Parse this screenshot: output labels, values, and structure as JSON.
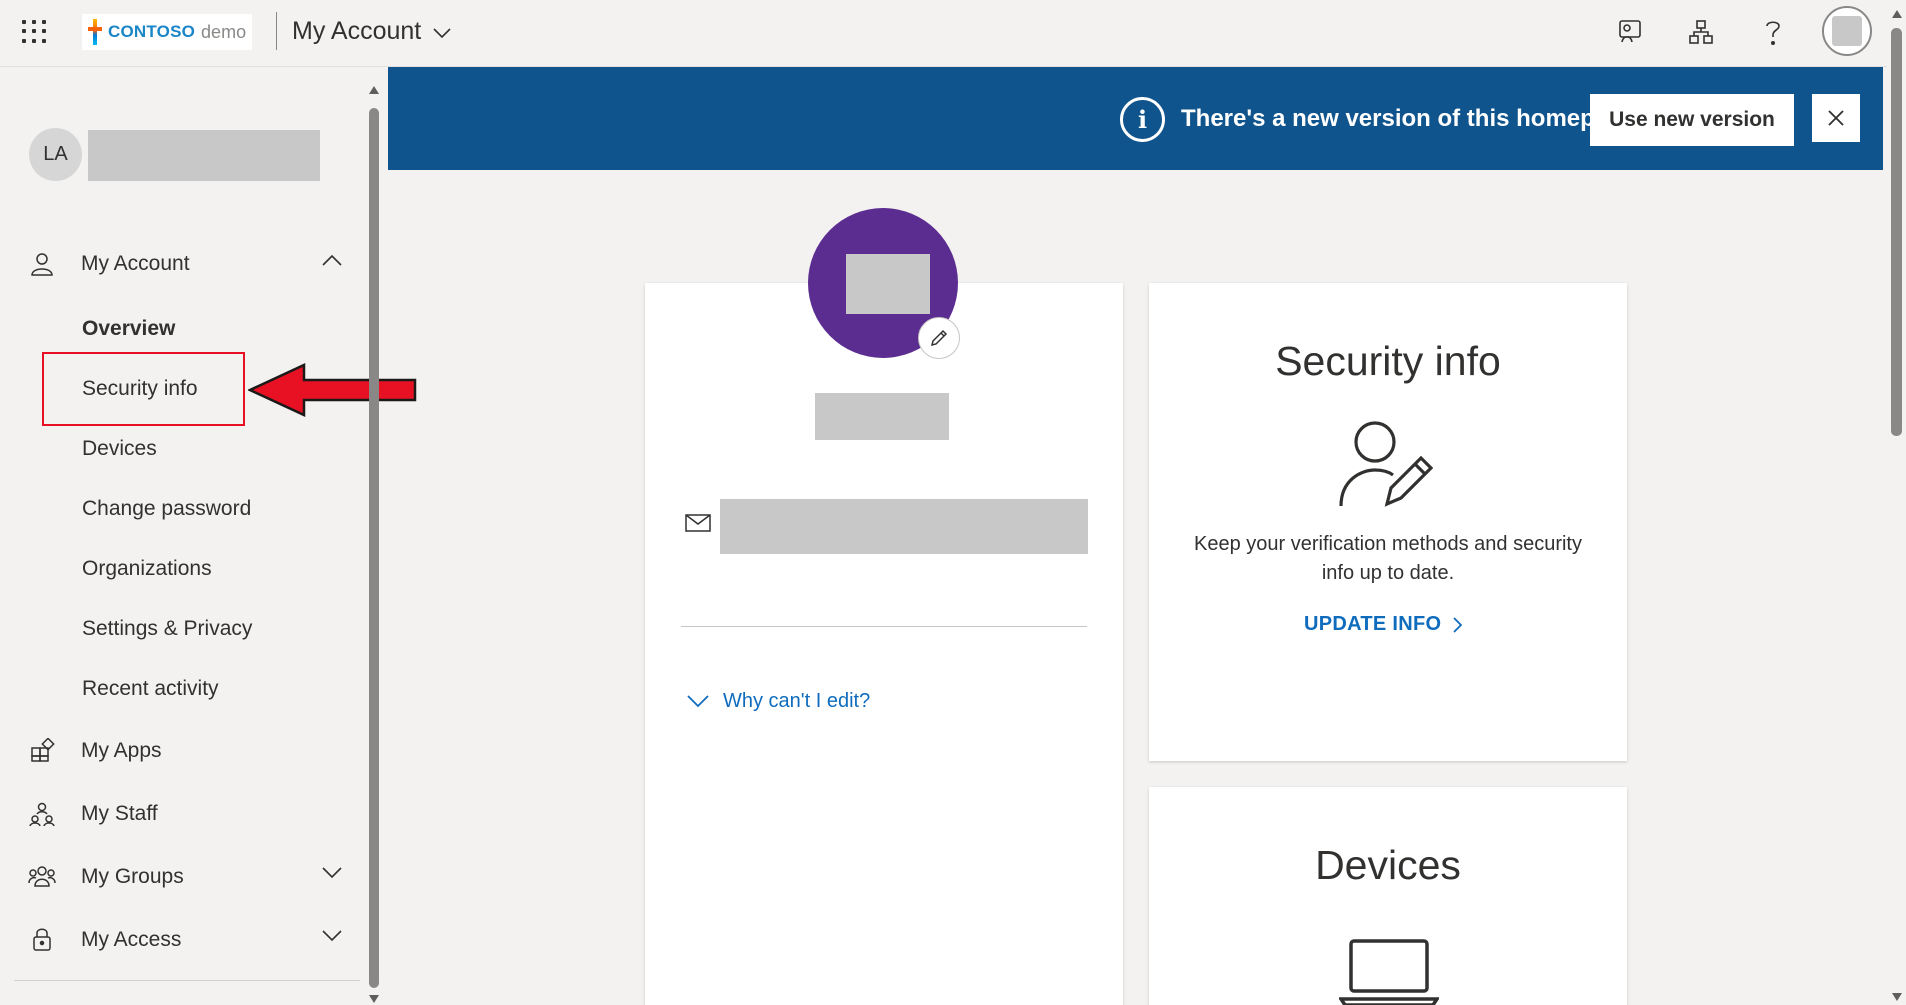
{
  "topbar": {
    "logo_brand": "CONTOSO",
    "logo_sub": "demo",
    "app_title": "My Account",
    "icons": [
      "app-launcher-icon",
      "feedback-icon",
      "org-chart-icon",
      "help-icon",
      "profile-avatar-icon"
    ]
  },
  "sidebar": {
    "user_initials": "LA",
    "my_account_label": "My Account",
    "sub_items": [
      {
        "label": "Overview",
        "selected": true
      },
      {
        "label": "Security info"
      },
      {
        "label": "Devices"
      },
      {
        "label": "Change password"
      },
      {
        "label": "Organizations"
      },
      {
        "label": "Settings & Privacy"
      },
      {
        "label": "Recent activity"
      }
    ],
    "items": [
      {
        "label": "My Apps",
        "icon": "apps-icon"
      },
      {
        "label": "My Staff",
        "icon": "staff-icon"
      },
      {
        "label": "My Groups",
        "icon": "groups-icon"
      },
      {
        "label": "My Access",
        "icon": "access-icon"
      }
    ]
  },
  "banner": {
    "message": "There's a new version of this homepage",
    "button_label": "Use new version",
    "info_glyph": "i"
  },
  "profile": {
    "why_edit_label": "Why can't I edit?"
  },
  "security_card": {
    "title": "Security info",
    "description": "Keep your verification methods and security info up to date.",
    "link_label": "UPDATE INFO"
  },
  "devices_card": {
    "title": "Devices"
  },
  "colors": {
    "banner": "#0f548c",
    "link": "#0f6cbd",
    "avatar_purple": "#5c2d91",
    "highlight_red": "#e81123"
  }
}
